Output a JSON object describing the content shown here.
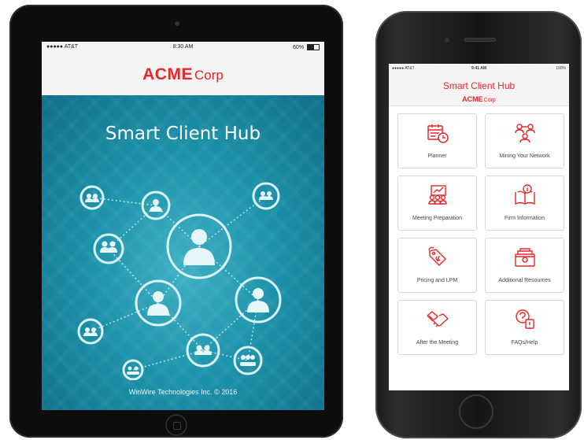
{
  "tablet": {
    "status": {
      "carrier": "●●●●● AT&T",
      "time": "8:30 AM",
      "battery": "60%"
    },
    "logo": {
      "acme": "ACME",
      "corp": "Corp"
    },
    "title": "Smart Client Hub",
    "footer": "WinWire Technologies Inc. © 2016",
    "colors": {
      "brand": "#e8262b",
      "hero": "#1c93aa"
    }
  },
  "phone": {
    "status": {
      "carrier": "●●●●● AT&T",
      "time": "9:41 AM",
      "battery": "100%"
    },
    "title": "Smart Client Hub",
    "logo": {
      "acme": "ACME",
      "corp": "Corp"
    },
    "tiles": [
      {
        "label": "Planner",
        "icon": "calendar-clock-icon"
      },
      {
        "label": "Mining Your Network",
        "icon": "network-people-icon"
      },
      {
        "label": "Meeting Preparation",
        "icon": "presentation-icon"
      },
      {
        "label": "Firm Information",
        "icon": "book-info-icon"
      },
      {
        "label": "Pricing and LPM",
        "icon": "price-tag-icon"
      },
      {
        "label": "Additional Resources",
        "icon": "folder-resources-icon"
      },
      {
        "label": "After the Meeting",
        "icon": "handshake-icon"
      },
      {
        "label": "FAQs/Help",
        "icon": "faq-help-icon"
      }
    ]
  }
}
